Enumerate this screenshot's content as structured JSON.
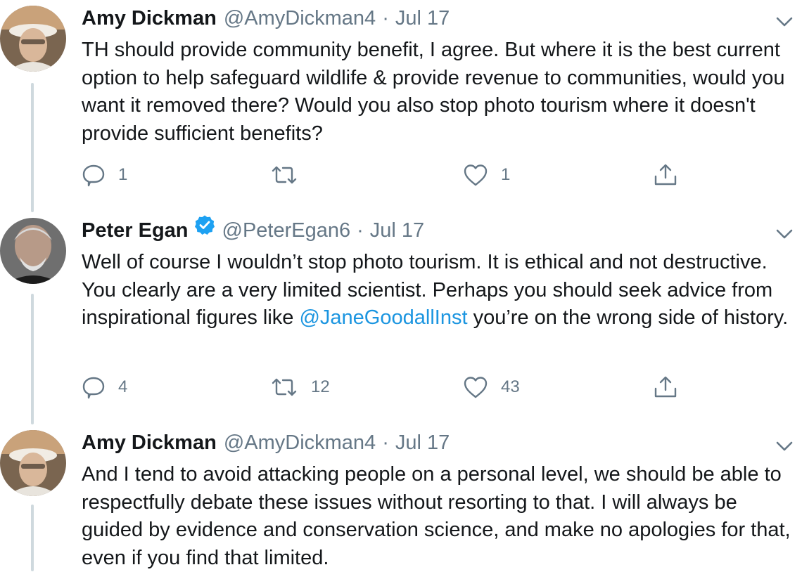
{
  "tweets": [
    {
      "name": "Amy Dickman",
      "handle": "@AmyDickman4",
      "separator": "·",
      "date": "Jul 17",
      "verified": false,
      "text": "TH should provide community benefit, I agree. But where it is the best current option to help safeguard wildlife & provide revenue to communities, would you want it removed there? Would you also stop photo tourism where it doesn't provide sufficient benefits?",
      "replies": "1",
      "retweets": "",
      "likes": "1"
    },
    {
      "name": "Peter Egan",
      "handle": "@PeterEgan6",
      "separator": "·",
      "date": "Jul 17",
      "verified": true,
      "text_before": "Well of course I wouldn’t stop photo tourism. It is ethical and not destructive. You clearly are a very limited scientist. Perhaps you should seek advice from inspirational figures like ",
      "mention": "@JaneGoodallInst",
      "text_after": " you’re on the wrong side of history.",
      "replies": "4",
      "retweets": "12",
      "likes": "43"
    },
    {
      "name": "Amy Dickman",
      "handle": "@AmyDickman4",
      "separator": "·",
      "date": "Jul 17",
      "verified": false,
      "text": "And I tend to avoid attacking people on a personal level, we should be able to respectfully debate these issues without resorting to that. I will always be guided by evidence and conservation science, and make no apologies for that, even if you find that limited."
    }
  ],
  "icons": {
    "reply": "reply-icon",
    "retweet": "retweet-icon",
    "like": "heart-icon",
    "share": "share-icon",
    "menu": "chevron-down-icon",
    "verified": "verified-badge-icon"
  },
  "colors": {
    "text": "#14171a",
    "secondary": "#657786",
    "link": "#1b95e0",
    "thread_line": "#cfd9de",
    "verified": "#1da1f2"
  }
}
